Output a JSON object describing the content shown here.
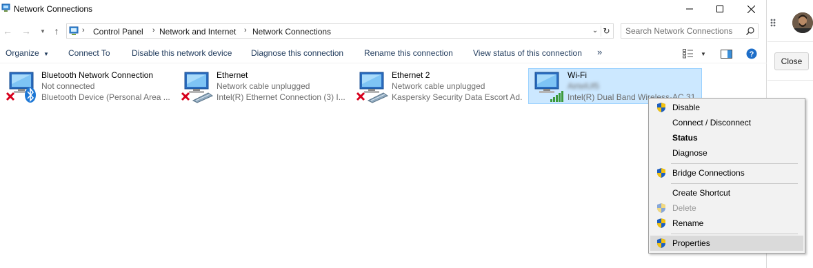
{
  "window": {
    "title": "Network Connections"
  },
  "address": {
    "crumbs": [
      "Control Panel",
      "Network and Internet",
      "Network Connections"
    ],
    "search_placeholder": "Search Network Connections"
  },
  "toolbar": {
    "organize": "Organize",
    "connect_to": "Connect To",
    "disable": "Disable this network device",
    "diagnose": "Diagnose this connection",
    "rename": "Rename this connection",
    "view_status": "View status of this connection",
    "more": "»"
  },
  "connections": [
    {
      "name": "Bluetooth Network Connection",
      "status": "Not connected",
      "device": "Bluetooth Device (Personal Area ..."
    },
    {
      "name": "Ethernet",
      "status": "Network cable unplugged",
      "device": "Intel(R) Ethernet Connection (3) I..."
    },
    {
      "name": "Ethernet 2",
      "status": "Network cable unplugged",
      "device": "Kaspersky Security Data Escort Ad..."
    },
    {
      "name": "Wi-Fi",
      "status": "AirtelUf5",
      "device": "Intel(R) Dual Band Wireless-AC 31"
    }
  ],
  "context_menu": {
    "items": [
      {
        "label": "Disable",
        "shield": true
      },
      {
        "label": "Connect / Disconnect",
        "shield": false
      },
      {
        "label": "Status",
        "shield": false,
        "bold": true
      },
      {
        "label": "Diagnose",
        "shield": false
      },
      {
        "label": "Bridge Connections",
        "shield": true
      },
      {
        "label": "Create Shortcut",
        "shield": false
      },
      {
        "label": "Delete",
        "shield": true,
        "disabled": true
      },
      {
        "label": "Rename",
        "shield": true
      },
      {
        "label": "Properties",
        "shield": true,
        "hover": true
      }
    ]
  },
  "background_app": {
    "close_label": "Close"
  },
  "colors": {
    "selection_bg": "#cce8ff",
    "selection_border": "#99d1ff",
    "toolbar_text": "#1e395b",
    "error_red": "#d6001c",
    "help_blue": "#1e6ec8"
  }
}
